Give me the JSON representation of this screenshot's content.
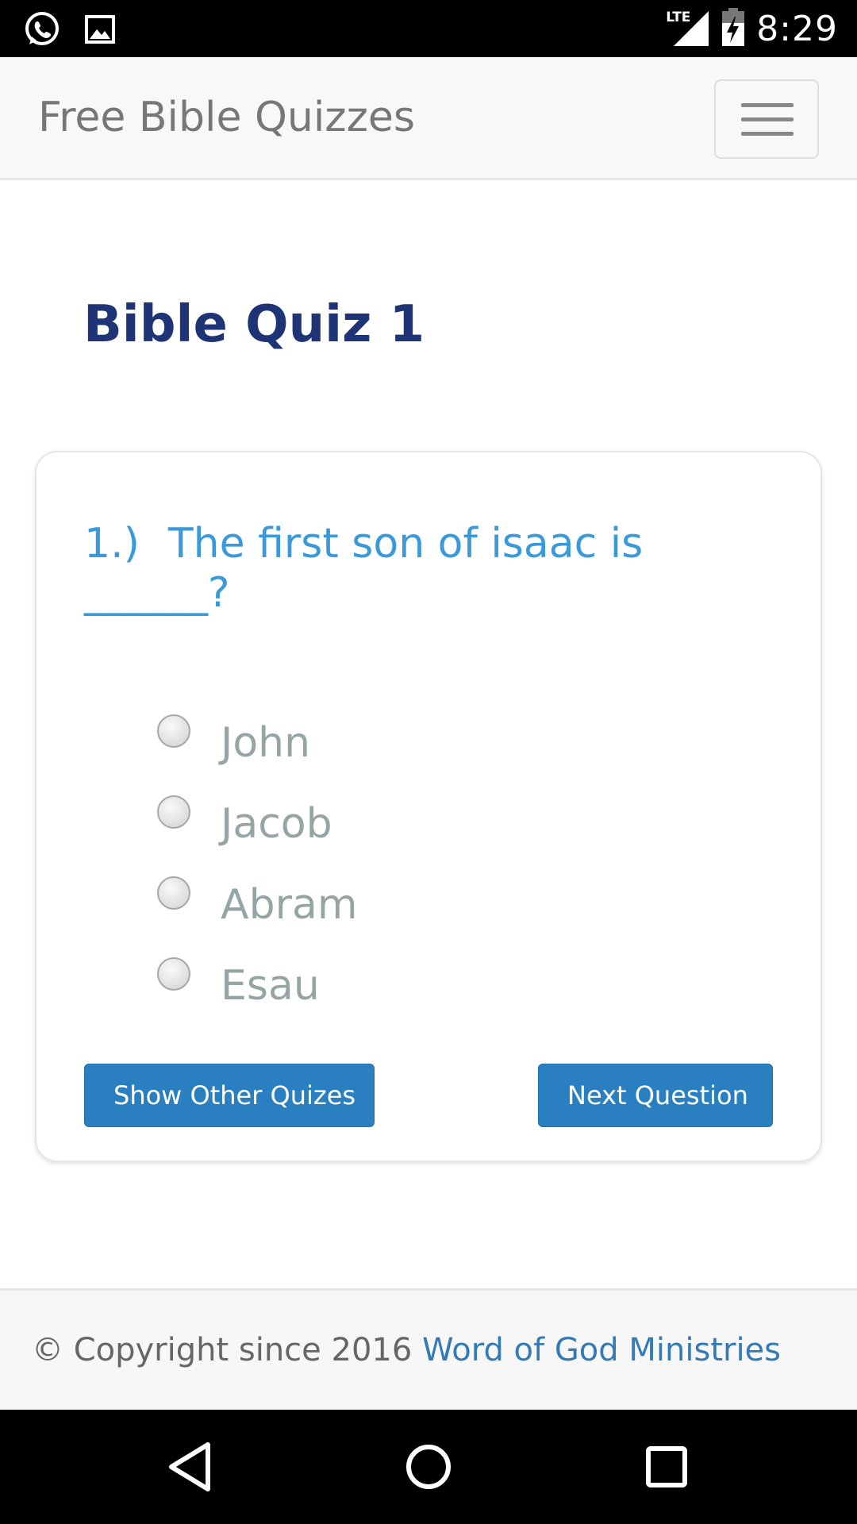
{
  "status_bar": {
    "time": "8:29",
    "network": "LTE",
    "left_icons": [
      "whatsapp-icon",
      "image-icon"
    ],
    "right_icons": [
      "signal-icon",
      "battery-charging-icon"
    ]
  },
  "navbar": {
    "brand": "Free Bible Quizzes",
    "menu_icon": "hamburger-icon"
  },
  "page": {
    "title": "Bible Quiz 1"
  },
  "quiz": {
    "question_number": "1.)",
    "question_text": "The first son of isaac is ______?",
    "options": [
      {
        "label": "John",
        "selected": false
      },
      {
        "label": "Jacob",
        "selected": false
      },
      {
        "label": "Abram",
        "selected": false
      },
      {
        "label": "Esau",
        "selected": false
      }
    ],
    "buttons": {
      "other_quizzes": "Show Other Quizes",
      "next_question": "Next Question"
    }
  },
  "footer": {
    "copyright_prefix": "© Copyright since 2016",
    "link_text": "Word of God Ministries"
  },
  "system_nav": {
    "icons": [
      "back-icon",
      "home-icon",
      "recents-icon"
    ]
  },
  "colors": {
    "title": "#1f3476",
    "question": "#3a9ad9",
    "option_text": "#95a5a6",
    "button": "#2a7fc0",
    "link": "#337ab7"
  }
}
